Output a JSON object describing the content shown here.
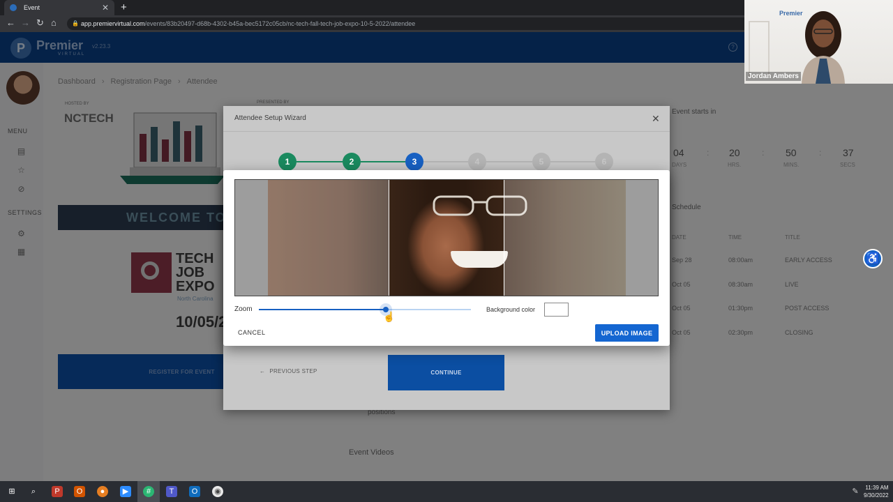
{
  "browser": {
    "tab_title": "Event",
    "url_domain": "app.premiervirtual.com",
    "url_path": "/events/83b20497-d68b-4302-b45a-bec5172c05cb/nc-tech-fall-tech-job-expo-10-5-2022/attendee"
  },
  "app": {
    "logo_letter": "P",
    "logo_name": "Premier",
    "logo_sub": "VIRTUAL",
    "version": "v2.23.3"
  },
  "sidebar": {
    "menu_label": "MENU",
    "settings_label": "SETTINGS"
  },
  "breadcrumb": [
    "Dashboard",
    "Registration Page",
    "Attendee"
  ],
  "event": {
    "hosted_by": "HOSTED BY",
    "presented_by": "PRESENTED BY",
    "host_name": "NCTECH",
    "welcome": "WELCOME TO T",
    "expo_title_lines": [
      "TECH",
      "JOB",
      "EXPO"
    ],
    "expo_sub": "North Carolina",
    "expo_date": "10/05/2",
    "register_label": "REGISTER FOR EVENT",
    "positions_text": "positions",
    "event_videos": "Event Videos"
  },
  "countdown": {
    "heading": "Event starts in",
    "items": [
      {
        "value": "04",
        "label": "DAYS"
      },
      {
        "value": "20",
        "label": "HRS."
      },
      {
        "value": "50",
        "label": "MINS."
      },
      {
        "value": "37",
        "label": "SECS"
      }
    ]
  },
  "schedule": {
    "heading": "Schedule",
    "columns": [
      "DATE",
      "TIME",
      "TITLE"
    ],
    "rows": [
      [
        "Sep 28",
        "08:00am",
        "EARLY ACCESS"
      ],
      [
        "Oct 05",
        "08:30am",
        "LIVE"
      ],
      [
        "Oct 05",
        "01:30pm",
        "POST ACCESS"
      ],
      [
        "Oct 05",
        "02:30pm",
        "CLOSING"
      ]
    ]
  },
  "wizard": {
    "title": "Attendee Setup Wizard",
    "steps": [
      {
        "n": "1",
        "state": "done"
      },
      {
        "n": "2",
        "state": "done"
      },
      {
        "n": "3",
        "state": "active"
      },
      {
        "n": "4",
        "state": "todo"
      },
      {
        "n": "5",
        "state": "todo"
      },
      {
        "n": "6",
        "state": "todo"
      }
    ],
    "prev_label": "PREVIOUS STEP",
    "continue_label": "CONTINUE"
  },
  "crop": {
    "zoom_label": "Zoom",
    "zoom_fraction": 0.6,
    "bg_color_label": "Background color",
    "bg_color_value": "#ffffff",
    "cancel_label": "CANCEL",
    "upload_label": "UPLOAD IMAGE"
  },
  "webcam": {
    "name": "Jordan Ambers",
    "logo": "Premier"
  },
  "clock": {
    "time": "11:39 AM",
    "date": "9/30/2022"
  },
  "colors": {
    "brand_blue": "#0a3f84",
    "step_done": "#1a8a5f",
    "step_active": "#1760c2",
    "upload_button": "#1466d1"
  }
}
